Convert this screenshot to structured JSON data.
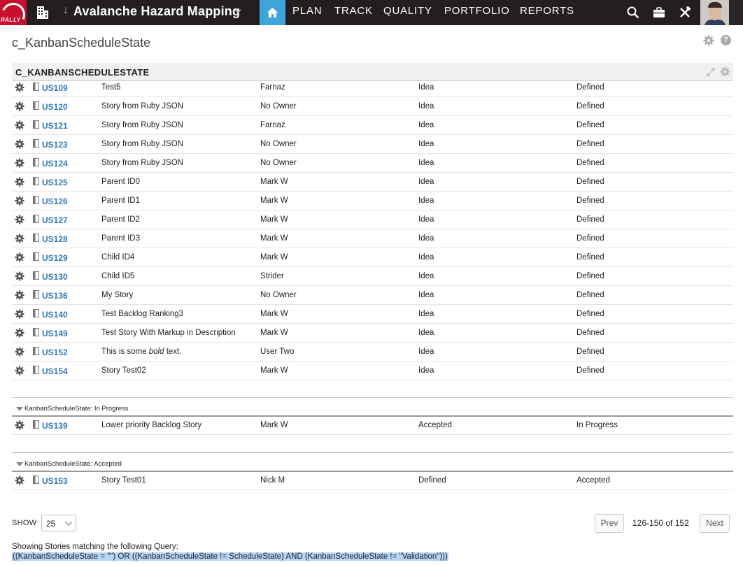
{
  "topbar": {
    "logo_text": "RALLY",
    "workspace_title": "Avalanche Hazard Mapping",
    "nav": [
      "PLAN",
      "TRACK",
      "QUALITY",
      "PORTFOLIO",
      "REPORTS"
    ]
  },
  "page": {
    "title": "c_KanbanScheduleState"
  },
  "panel": {
    "title": "C_KANBANSCHEDULESTATE"
  },
  "rows_defined": [
    {
      "id": "US109",
      "name": "Test5",
      "owner": "Farnaz",
      "schedule_state": "Idea",
      "kanban_state": "Defined"
    },
    {
      "id": "US120",
      "name": "Story from Ruby JSON",
      "owner": "No Owner",
      "schedule_state": "Idea",
      "kanban_state": "Defined"
    },
    {
      "id": "US121",
      "name": "Story from Ruby JSON",
      "owner": "Farnaz",
      "schedule_state": "Idea",
      "kanban_state": "Defined"
    },
    {
      "id": "US123",
      "name": "Story from Ruby JSON",
      "owner": "No Owner",
      "schedule_state": "Idea",
      "kanban_state": "Defined"
    },
    {
      "id": "US124",
      "name": "Story from Ruby JSON",
      "owner": "No Owner",
      "schedule_state": "Idea",
      "kanban_state": "Defined"
    },
    {
      "id": "US125",
      "name": "Parent ID0",
      "owner": "Mark W",
      "schedule_state": "Idea",
      "kanban_state": "Defined"
    },
    {
      "id": "US126",
      "name": "Parent ID1",
      "owner": "Mark W",
      "schedule_state": "Idea",
      "kanban_state": "Defined"
    },
    {
      "id": "US127",
      "name": "Parent ID2",
      "owner": "Mark W",
      "schedule_state": "Idea",
      "kanban_state": "Defined"
    },
    {
      "id": "US128",
      "name": "Parent ID3",
      "owner": "Mark W",
      "schedule_state": "Idea",
      "kanban_state": "Defined"
    },
    {
      "id": "US129",
      "name": "Child ID4",
      "owner": "Mark W",
      "schedule_state": "Idea",
      "kanban_state": "Defined"
    },
    {
      "id": "US130",
      "name": "Child ID5",
      "owner": "Strider",
      "schedule_state": "Idea",
      "kanban_state": "Defined"
    },
    {
      "id": "US136",
      "name": "My Story",
      "owner": "No Owner",
      "schedule_state": "Idea",
      "kanban_state": "Defined"
    },
    {
      "id": "US140",
      "name": "Test Backlog Ranking3",
      "owner": "Mark W",
      "schedule_state": "Idea",
      "kanban_state": "Defined"
    },
    {
      "id": "US149",
      "name": "Test Story With Markup in Description",
      "owner": "Mark W",
      "schedule_state": "Idea",
      "kanban_state": "Defined"
    },
    {
      "id": "US152",
      "name": "This is some bold text.",
      "owner": "User Two",
      "schedule_state": "Idea",
      "kanban_state": "Defined"
    },
    {
      "id": "US154",
      "name": "Story Test02",
      "owner": "Mark W",
      "schedule_state": "Idea",
      "kanban_state": "Defined"
    }
  ],
  "groups": [
    {
      "label": "KanbanScheduleState: In Progress",
      "rows": [
        {
          "id": "US139",
          "name": "Lower priority Backlog Story",
          "owner": "Mark W",
          "schedule_state": "Accepted",
          "kanban_state": "In Progress"
        }
      ]
    },
    {
      "label": "KanbanScheduleState: Accepted",
      "rows": [
        {
          "id": "US153",
          "name": "Story Test01",
          "owner": "Nick M",
          "schedule_state": "Defined",
          "kanban_state": "Accepted"
        }
      ]
    }
  ],
  "pager": {
    "show_label": "SHOW",
    "page_size": "25",
    "prev_label": "Prev",
    "range_text": "126-150 of 152",
    "next_label": "Next"
  },
  "query": {
    "label": "Showing Stories matching the following Query:",
    "text": "((KanbanScheduleState = \"\") OR ((KanbanScheduleState != ScheduleState) AND (KanbanScheduleState != \"Validation\")))"
  },
  "colors": {
    "topbar": "#231f20",
    "accent": "#3da5d9",
    "brand": "#c8102e",
    "link": "#337ab7",
    "highlight": "#b5d5f5"
  },
  "icons": [
    "rally-logo-icon",
    "building-icon",
    "chevron-down-icon",
    "home-icon",
    "search-icon",
    "briefcase-icon",
    "tools-icon",
    "gear-icon",
    "help-icon",
    "expand-icon",
    "story-doc-icon",
    "triangle-collapse-icon"
  ]
}
